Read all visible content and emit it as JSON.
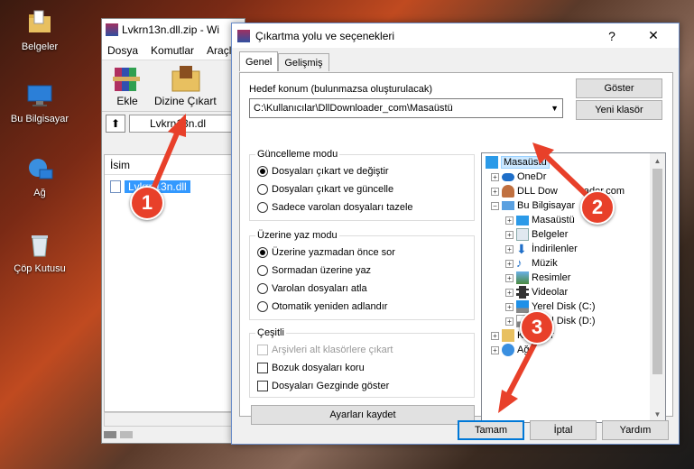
{
  "desktop": {
    "icons": [
      {
        "label": "Belgeler"
      },
      {
        "label": "Bu Bilgisayar"
      },
      {
        "label": "Ağ"
      },
      {
        "label": "Çöp Kutusu"
      }
    ]
  },
  "winrar": {
    "title": "Lvkrn13n.dll.zip - Wi",
    "menu": [
      "Dosya",
      "Komutlar",
      "Araçla"
    ],
    "toolbar": {
      "add_label": "Ekle",
      "extract_label": "Dizine Çıkart"
    },
    "path": "Lvkrn13n.dl",
    "column_name": "İsim",
    "file": "Lvkrn13n.dll"
  },
  "dialog": {
    "title": "Çıkartma yolu ve seçenekleri",
    "help": "?",
    "close": "✕",
    "tabs": [
      "Genel",
      "Gelişmiş"
    ],
    "dest_label": "Hedef konum (bulunmazsa oluşturulacak)",
    "dest_value": "C:\\Kullanıcılar\\DllDownloader_com\\Masaüstü",
    "show_button": "Göster",
    "new_folder_button": "Yeni klasör",
    "update_group": {
      "title": "Güncelleme modu",
      "options": [
        "Dosyaları çıkart ve değiştir",
        "Dosyaları çıkart ve güncelle",
        "Sadece varolan dosyaları tazele"
      ]
    },
    "overwrite_group": {
      "title": "Üzerine yaz modu",
      "options": [
        "Üzerine yazmadan önce sor",
        "Sormadan üzerine yaz",
        "Varolan dosyaları atla",
        "Otomatik yeniden adlandır"
      ]
    },
    "misc_group": {
      "title": "Çeşitli",
      "options": [
        "Arşivleri alt klasörlere çıkart",
        "Bozuk dosyaları koru",
        "Dosyaları Gezginde göster"
      ]
    },
    "save_settings": "Ayarları kaydet",
    "tree": {
      "root": "Masaüstü",
      "onedrive": "OneDr",
      "dlldownloader": "DLL Dow",
      "dlldownloader_tail": "ader.com",
      "this_pc": "Bu Bilgisayar",
      "desktop": "Masaüstü",
      "documents": "Belgeler",
      "downloads": "İndirilenler",
      "music": "Müzik",
      "pictures": "Resimler",
      "videos": "Videolar",
      "disk_c": "Yerel Disk (C:)",
      "disk_d": "Yerel Disk (D:)",
      "libraries": "Kitapl",
      "libraries_tail": "lar",
      "network": "Ağ"
    },
    "ok": "Tamam",
    "cancel": "İptal",
    "help_button": "Yardım"
  },
  "badges": [
    "1",
    "2",
    "3"
  ],
  "colors": {
    "badge": "#e8402a",
    "selection": "#cce8ff",
    "accent": "#0078d7"
  }
}
